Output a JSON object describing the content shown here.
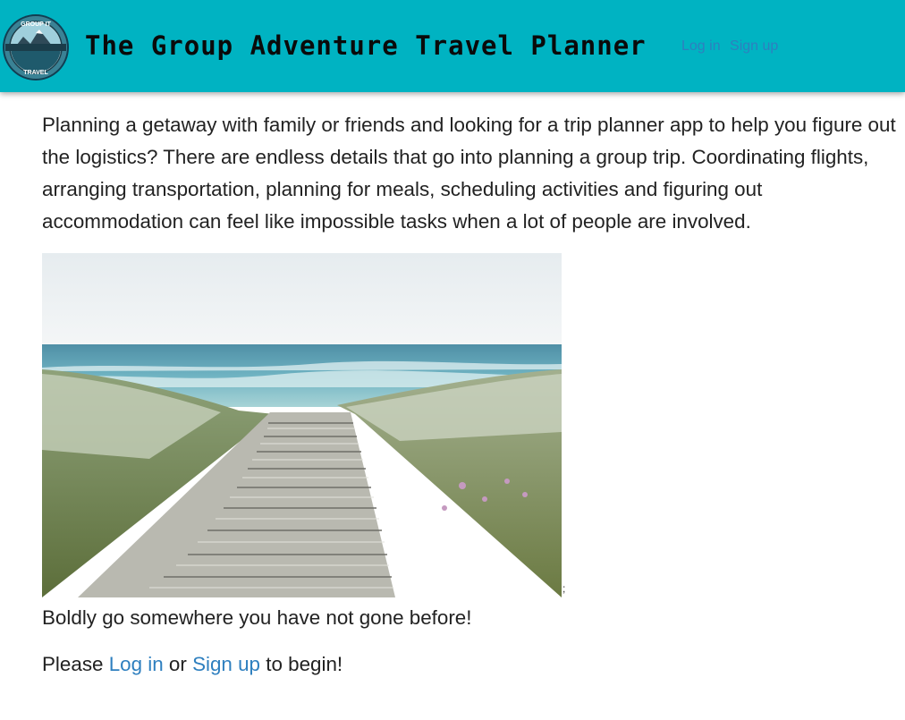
{
  "header": {
    "logo_alt": "Group It Travel logo",
    "logo_top_text": "GROUP IT",
    "logo_bottom_text": "TRAVEL",
    "title": "The Group Adventure Travel Planner",
    "nav": {
      "login": "Log in",
      "signup": "Sign up"
    },
    "bg_color": "#00b3c2"
  },
  "main": {
    "intro": "Planning a getaway with family or friends and looking for a trip planner app to help you figure out the logistics? There are endless details that go into planning a group trip. Coordinating flights, arranging transportation, planning for meals, scheduling activities and figuring out accommodation can feel like impossible tasks when a lot of people are involved.",
    "hero_alt": "Wooden boardwalk leading through beach grass to the ocean",
    "hero_trailing": ";",
    "tagline": "Boldly go somewhere you have not gone before!",
    "cta": {
      "before": "Please ",
      "login": "Log in",
      "middle": " or ",
      "signup": "Sign up",
      "after": " to begin!"
    },
    "link_color": "#2e7fbf"
  }
}
